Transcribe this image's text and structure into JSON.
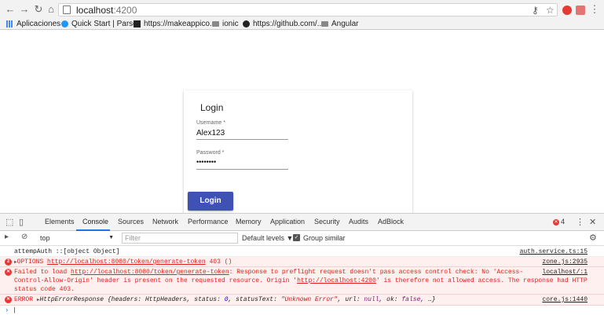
{
  "browser": {
    "url": "localhost",
    "url_port": ":4200",
    "bookmarks": [
      {
        "label": "Aplicaciones",
        "icon": "apps-grid-icon"
      },
      {
        "label": "Quick Start | Parse",
        "icon": "parse-icon"
      },
      {
        "label": "https://makeappico...",
        "icon": "bookmark-site-icon"
      },
      {
        "label": "ionic",
        "icon": "folder-icon"
      },
      {
        "label": "https://github.com/...",
        "icon": "github-icon"
      },
      {
        "label": "Angular",
        "icon": "folder-icon"
      }
    ]
  },
  "login": {
    "title": "Login",
    "username_label": "Username *",
    "username_value": "Alex123",
    "password_label": "Password *",
    "password_value": "••••••••",
    "button_label": "Login"
  },
  "devtools": {
    "tabs": [
      "Elements",
      "Console",
      "Sources",
      "Network",
      "Performance",
      "Memory",
      "Application",
      "Security",
      "Audits",
      "AdBlock"
    ],
    "active_tab": "Console",
    "error_count": "4",
    "context": "top",
    "filter_placeholder": "Filter",
    "levels_label": "Default levels ▼",
    "group_similar_label": "Group similar",
    "accent_color": "#1a73e8",
    "error_color": "#e53935"
  },
  "console": {
    "log1": {
      "msg": "attempAuth ::[object Object]",
      "src": "auth.service.ts:15"
    },
    "err1": {
      "count": "2",
      "prefix": "OPTIONS ",
      "url": "http://localhost:8080/token/generate-token",
      "suffix": " 403 ()",
      "src": "zone.js:2935"
    },
    "err2": {
      "line1_prefix": "Failed to load ",
      "line1_url": "http://localhost:8080/token/generate-token",
      "line1_suffix": ": Response to preflight request doesn't pass access control check: No 'Access-",
      "line2_prefix": "Control-Allow-Origin' header is present on the requested resource. Origin '",
      "line2_url": "http://localhost:4200",
      "line2_suffix": "' is therefore not allowed access. The response had HTTP",
      "line3": "status code 403.",
      "src": "localhost/:1"
    },
    "err3": {
      "prefix": "ERROR ",
      "obj": "HttpErrorResponse {headers: HttpHeaders, status: ",
      "status": "0",
      "mid1": ", statusText: ",
      "statusText": "\"Unknown Error\"",
      "mid2": ", url: ",
      "urlval": "null",
      "mid3": ", ok: ",
      "okval": "false",
      "end": ", …}",
      "src": "core.js:1440"
    }
  }
}
